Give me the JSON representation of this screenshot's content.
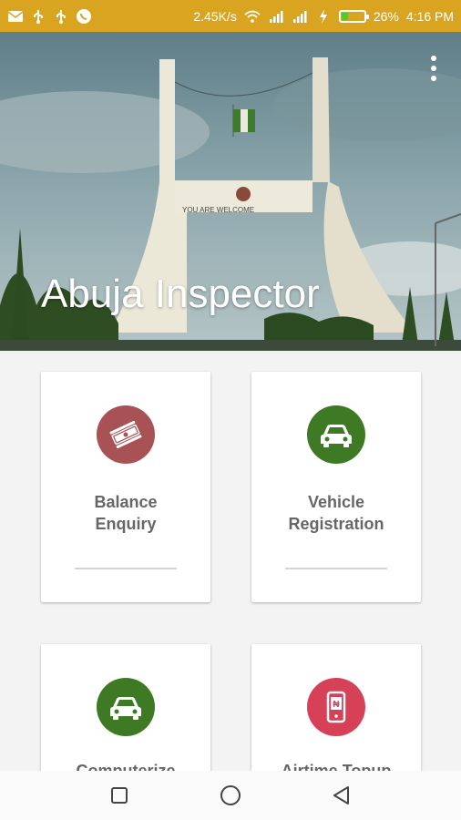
{
  "status_bar": {
    "net_speed": "2.45K/s",
    "battery_percent": "26%",
    "battery_level": 0.26,
    "time": "4:16 PM",
    "left_icons": [
      "mail-icon",
      "usb-icon",
      "usb-icon",
      "whatsapp-icon"
    ],
    "right_icons": [
      "wifi-icon",
      "signal-icon",
      "signal-icon",
      "charging-icon"
    ]
  },
  "header": {
    "title": "Abuja Inspector",
    "overflow_icon": "more-vertical-icon"
  },
  "cards": [
    {
      "label": "Balance Enquiry",
      "label_lines": [
        "Balance",
        "Enquiry"
      ],
      "icon": "money-icon",
      "color": "#a85255"
    },
    {
      "label": "Vehicle Registration",
      "label_lines": [
        "Vehicle",
        "Registration"
      ],
      "icon": "car-icon",
      "color": "#3e7a23"
    },
    {
      "label": "Computerize",
      "label_lines": [
        "Computerize"
      ],
      "icon": "car-icon",
      "color": "#3e7a23"
    },
    {
      "label": "Airtime Topup",
      "label_lines": [
        "Airtime Topup"
      ],
      "icon": "mobile-topup-icon",
      "color": "#d64157"
    }
  ],
  "nav_bar": {
    "recents_icon": "square-icon",
    "home_icon": "circle-icon",
    "back_icon": "back-triangle-icon"
  },
  "colors": {
    "status_bar": "#d9a521",
    "background": "#f3f3f3"
  }
}
